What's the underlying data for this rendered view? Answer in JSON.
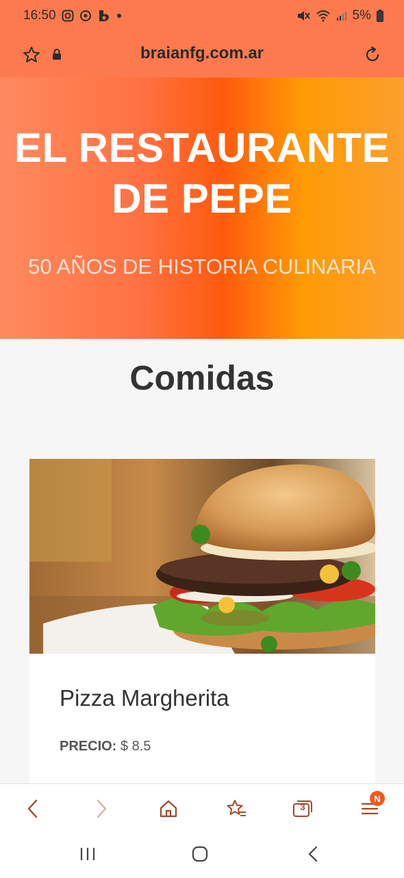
{
  "status": {
    "time": "16:50",
    "battery": "5%"
  },
  "browser": {
    "url": "braianfg.com.ar",
    "tab_count": "3",
    "menu_badge": "N"
  },
  "hero": {
    "title_line1": "EL RESTAURANTE",
    "title_line2": "DE PEPE",
    "subtitle": "50 AÑOS DE HISTORIA CULINARIA"
  },
  "section": {
    "title": "Comidas"
  },
  "card": {
    "name": "Pizza Margherita",
    "price_label": "PRECIO:",
    "price_value": "$ 8.5"
  },
  "colors": {
    "accent": "#fd7a4f",
    "hero_orange": "#ff5a0e",
    "hero_yellow": "#ff9a06",
    "badge": "#f05a1f"
  },
  "icons": {
    "status_left": [
      "instagram-icon",
      "app-icon",
      "b-app-icon",
      "notification-dot-icon"
    ],
    "status_right": [
      "mute-icon",
      "wifi-icon",
      "signal-icon",
      "battery-icon"
    ],
    "toolbar": [
      "back-icon",
      "forward-icon",
      "home-icon",
      "bookmarks-icon",
      "tabs-icon",
      "menu-icon"
    ],
    "system": [
      "recents-icon",
      "home-circle-icon",
      "system-back-icon"
    ]
  }
}
